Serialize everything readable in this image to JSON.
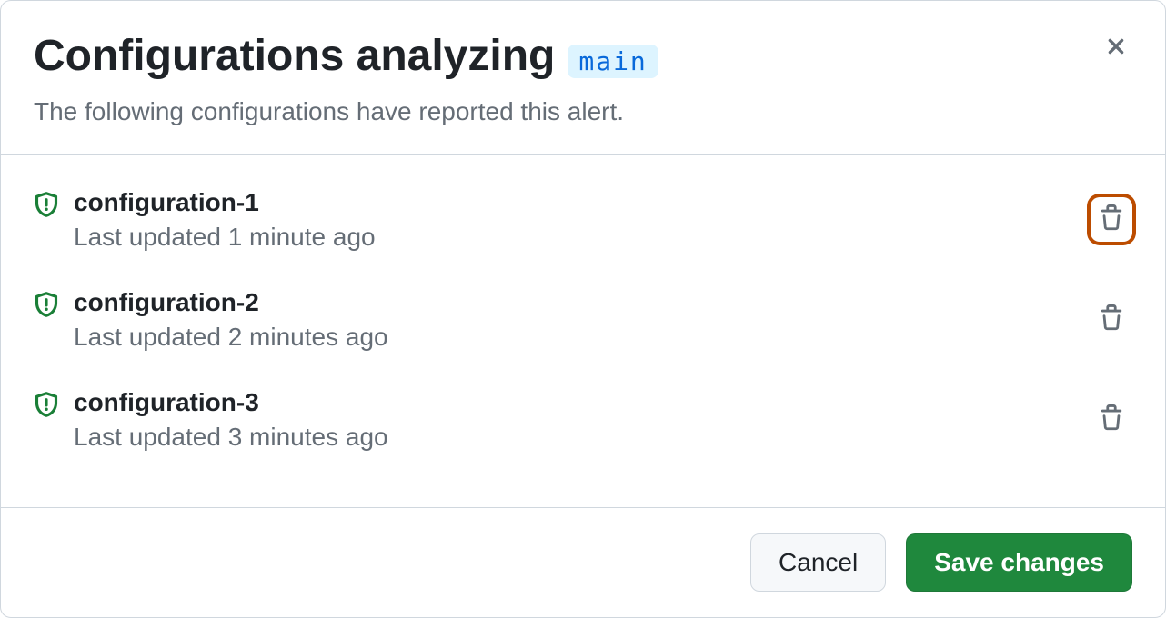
{
  "header": {
    "title": "Configurations analyzing",
    "branch": "main",
    "subtitle": "The following configurations have reported this alert."
  },
  "configurations": [
    {
      "name": "configuration-1",
      "updated": "Last updated 1 minute ago",
      "highlighted": true
    },
    {
      "name": "configuration-2",
      "updated": "Last updated 2 minutes ago",
      "highlighted": false
    },
    {
      "name": "configuration-3",
      "updated": "Last updated 3 minutes ago",
      "highlighted": false
    }
  ],
  "footer": {
    "cancel_label": "Cancel",
    "save_label": "Save changes"
  },
  "colors": {
    "shield_icon": "#1a7f37",
    "highlight": "#bc4c00"
  }
}
